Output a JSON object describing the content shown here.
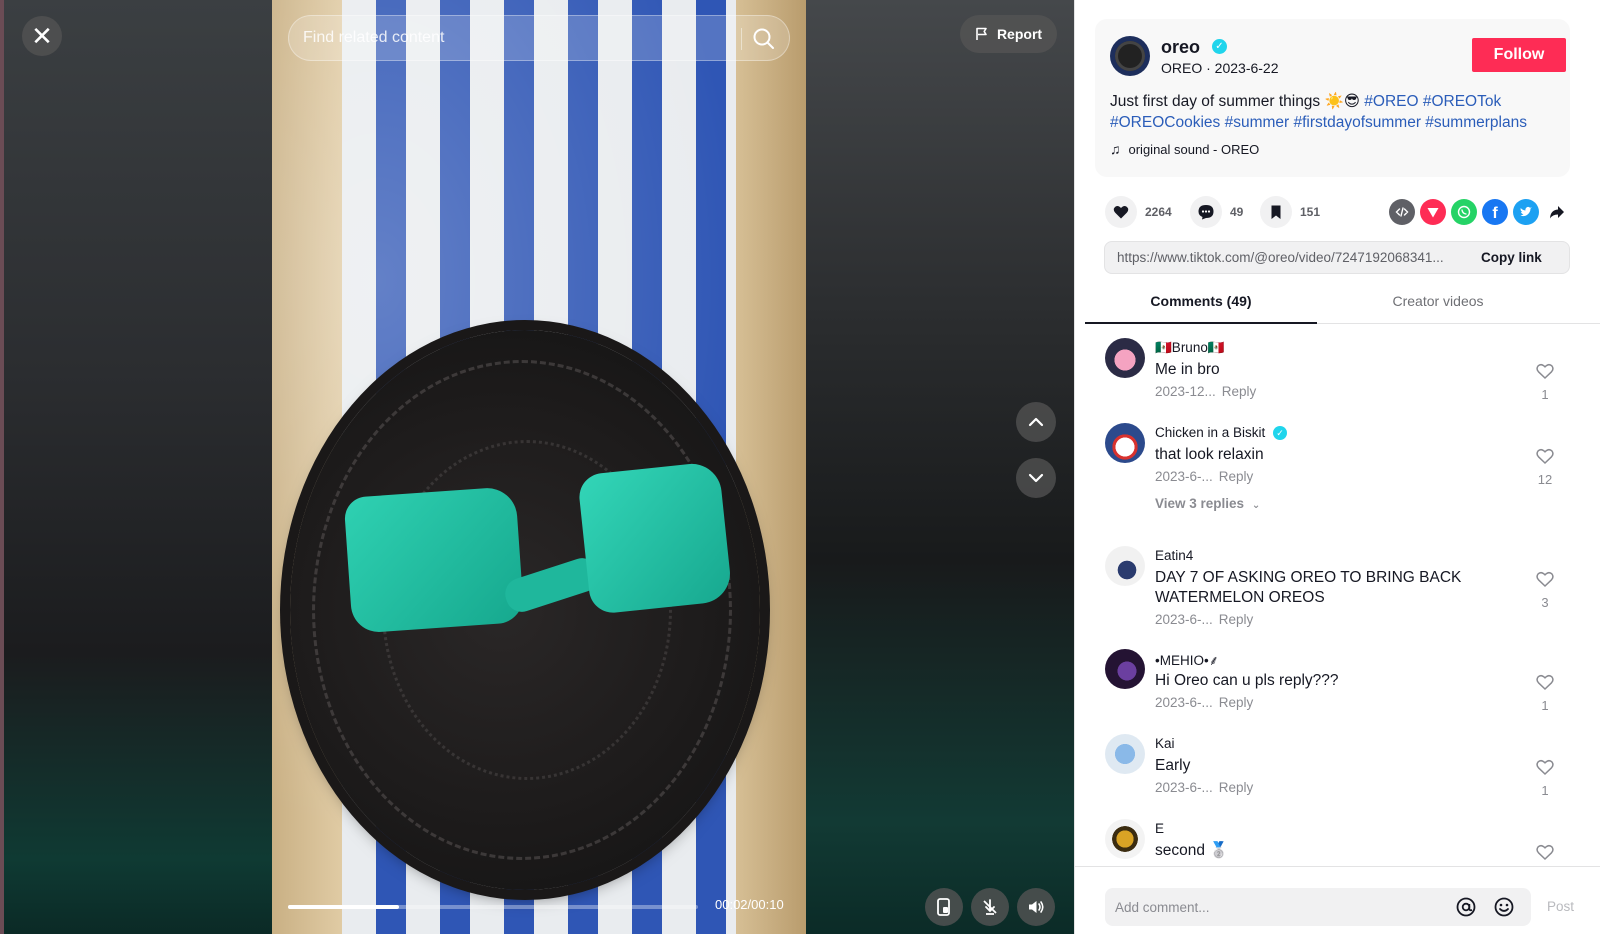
{
  "player": {
    "search_placeholder": "Find related content",
    "report_label": "Report",
    "time": "00:02/00:10",
    "progress_fraction": 0.27
  },
  "post": {
    "author": "oreo",
    "author_sub": "OREO · 2023-6-22",
    "follow_label": "Follow",
    "caption_text": "Just first day of summer things ☀️😎 ",
    "hashtags": [
      "#OREO",
      "#OREOTok",
      "#OREOCookies",
      "#summer",
      "#firstdayofsummer",
      "#summerplans"
    ],
    "music": "original sound - OREO",
    "likes": "2264",
    "comments": "49",
    "saves": "151",
    "link": "https://www.tiktok.com/@oreo/video/7247192068341...",
    "copy_label": "Copy link"
  },
  "tabs": [
    {
      "label": "Comments (49)",
      "active": true
    },
    {
      "label": "Creator videos",
      "active": false
    }
  ],
  "comments": [
    {
      "name": "🇲🇽Bruno🇲🇽",
      "text": "Me in bro",
      "date": "2023-12...",
      "reply": "Reply",
      "likes": "1"
    },
    {
      "name": "Chicken in a Biskit",
      "text": "that look relaxin",
      "date": "2023-6-...",
      "reply": "Reply",
      "likes": "12",
      "view_replies": "View 3 replies"
    },
    {
      "name": "Eatin4",
      "text": "DAY 7 OF ASKING OREO TO BRING BACK WATERMELON OREOS",
      "date": "2023-6-...",
      "reply": "Reply",
      "likes": "3"
    },
    {
      "name": "•MEHIO•⸙",
      "text": "Hi Oreo can u pls reply???",
      "date": "2023-6-...",
      "reply": "Reply",
      "likes": "1"
    },
    {
      "name": "Kai",
      "text": "Early",
      "date": "2023-6-...",
      "reply": "Reply",
      "likes": "1"
    },
    {
      "name": "E",
      "text": "second 🥈",
      "date": "",
      "reply": "",
      "likes": ""
    }
  ],
  "composer": {
    "placeholder": "Add comment...",
    "post_label": "Post"
  },
  "colors": {
    "accent": "#fe2c55",
    "hashtag": "#2b5db9",
    "verified": "#20d5ec"
  }
}
